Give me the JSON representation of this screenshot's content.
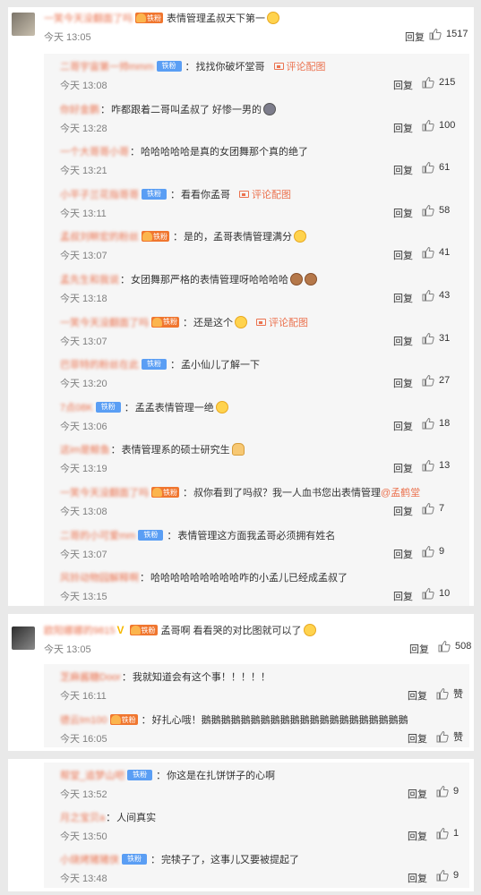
{
  "reply_label": "回复",
  "praise_label": "赞",
  "badges": {
    "iron": "铁粉",
    "fan_prefix": "铁粉"
  },
  "pic_link": "评论配图",
  "panel1": {
    "main": {
      "username": "一笑今天没翻面了吗",
      "text": "表情管理孟叔天下第一",
      "time": "今天 13:05",
      "likes": "1517"
    },
    "replies": [
      {
        "username": "二哥宇宙第一帅mmm",
        "badge": "iron",
        "text": "找找你破坏堂哥",
        "pic": true,
        "time": "今天 13:08",
        "likes": "215",
        "emoji": ""
      },
      {
        "username": "你好金鹏",
        "badge": "",
        "text": "咋都跟着二哥叫孟叔了 好惨一男的",
        "pic": false,
        "time": "今天 13:28",
        "likes": "100",
        "emoji": "dark"
      },
      {
        "username": "一个大哥哥小哥",
        "badge": "",
        "text": "哈哈哈哈哈是真的女团舞那个真的绝了",
        "pic": false,
        "time": "今天 13:21",
        "likes": "61",
        "emoji": ""
      },
      {
        "username": "小平子兰花指哥哥",
        "badge": "iron",
        "text": "看看你孟哥",
        "pic": true,
        "time": "今天 13:11",
        "likes": "58",
        "emoji": ""
      },
      {
        "username": "孟叔刘畊宏的粉丝",
        "badge": "fan",
        "text": "是的，孟哥表情管理满分",
        "pic": false,
        "time": "今天 13:07",
        "likes": "41",
        "emoji": "yellow"
      },
      {
        "username": "孟先生和我说",
        "badge": "",
        "text": "女团舞那严格的表情管理呀哈哈哈哈",
        "pic": false,
        "time": "今天 13:18",
        "likes": "43",
        "emoji": "monkey2"
      },
      {
        "username": "一笑今天没翻面了吗",
        "badge": "fan",
        "text": "还是这个",
        "pic": true,
        "time": "今天 13:07",
        "likes": "31",
        "emoji": "yellow"
      },
      {
        "username": "巴菲特的粉丝在此",
        "badge": "iron",
        "text": "孟小仙儿了解一下",
        "pic": false,
        "time": "今天 13:20",
        "likes": "27",
        "emoji": ""
      },
      {
        "username": "7点08K",
        "badge": "iron",
        "text": "孟孟表情管理一绝",
        "pic": false,
        "time": "今天 13:06",
        "likes": "18",
        "emoji": "yellow"
      },
      {
        "username": "这im是鲸鱼",
        "badge": "",
        "text": "表情管理系的硕士研究生",
        "pic": false,
        "time": "今天 13:19",
        "likes": "13",
        "emoji": "folded"
      },
      {
        "username": "一笑今天没翻面了吗",
        "badge": "fan",
        "text": "叔你看到了吗叔？我一人血书您出表情管理",
        "at": "@孟鹤堂",
        "pic": false,
        "time": "今天 13:08",
        "likes": "7",
        "emoji": ""
      },
      {
        "username": "二哥的小可爱mm",
        "badge": "iron",
        "text": "表情管理这方面我孟哥必须拥有姓名",
        "pic": false,
        "time": "今天 13:07",
        "likes": "9",
        "emoji": ""
      },
      {
        "username": "风铃动物园解释啊",
        "badge": "",
        "text": "哈哈哈哈哈哈哈哈哈咋的小孟儿已经成孟叔了",
        "pic": false,
        "time": "今天 13:15",
        "likes": "10",
        "emoji": ""
      }
    ]
  },
  "panel2": {
    "main": {
      "username": "欧阳娜娜的9815",
      "text": "孟哥啊 看看哭的对比图就可以了",
      "time": "今天 13:05",
      "likes": "508"
    },
    "replies": [
      {
        "username": "芝麻酱糖Door",
        "text": "我就知道会有这个事！！！！！",
        "time": "今天 16:11"
      },
      {
        "username": "德云Im100",
        "badge": "fan",
        "text": "好扎心哦！鵝鵝鵝鵝鵝鵝鵝鵝鵝鵝鵝鵝鵝鵝鵝鵝鵝鵝鵝鵝鵝",
        "time": "今天 16:05"
      }
    ]
  },
  "panel3": {
    "replies": [
      {
        "username": "帮堂_追梦山吧",
        "badge": "iron",
        "text": "你这是在扎饼饼子的心啊",
        "time": "今天 13:52",
        "likes": "9"
      },
      {
        "username": "月之宝贝a",
        "badge": "",
        "text": "人间真实",
        "time": "今天 13:50",
        "likes": "1"
      },
      {
        "username": "小烧烤猪猪侠",
        "badge": "iron",
        "text": "完犊子了，这事儿又要被提起了",
        "time": "今天 13:48",
        "likes": "9"
      }
    ]
  },
  "colors": {
    "accent": "#eb7350",
    "badge_blue": "#5a9ef4",
    "badge_orange": "#f0762f",
    "time": "#808080"
  }
}
